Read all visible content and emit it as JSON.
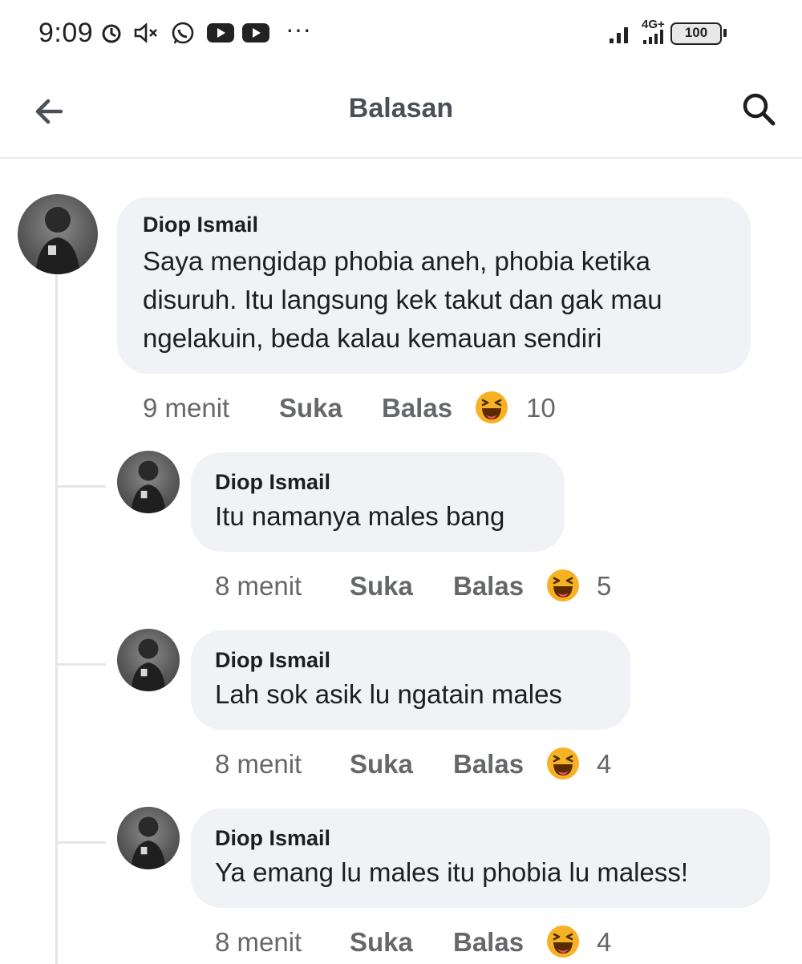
{
  "status_bar": {
    "time": "9:09",
    "network_label": "4G+",
    "battery": "100",
    "overflow": "···",
    "icons": [
      "alarm-icon",
      "mute-icon",
      "whatsapp-icon",
      "youtube-icon",
      "youtube-icon",
      "signal-icon",
      "battery-icon"
    ]
  },
  "header": {
    "title": "Balasan",
    "back_icon": "arrow-left-icon",
    "search_icon": "search-icon"
  },
  "colors": {
    "bubble": "#f0f2f5",
    "meta": "#65676b",
    "text": "#1c1e21",
    "haha": "#f7b125"
  },
  "comments": [
    {
      "author": "Diop Ismail",
      "text_lines": [
        "Saya mengidap phobia aneh, phobia ketika",
        "disuruh. Itu langsung kek takut dan gak mau",
        "ngelakuin, beda kalau kemauan sendiri"
      ],
      "time": "9 menit",
      "like": "Suka",
      "reply": "Balas",
      "reaction_icon": "haha-emoji-icon",
      "reaction_count": "10"
    },
    {
      "author": "Diop Ismail",
      "text_lines": [
        "Itu namanya males bang"
      ],
      "time": "8 menit",
      "like": "Suka",
      "reply": "Balas",
      "reaction_icon": "haha-emoji-icon",
      "reaction_count": "5"
    },
    {
      "author": "Diop Ismail",
      "text_lines": [
        "Lah sok asik lu ngatain males"
      ],
      "time": "8 menit",
      "like": "Suka",
      "reply": "Balas",
      "reaction_icon": "haha-emoji-icon",
      "reaction_count": "4"
    },
    {
      "author": "Diop Ismail",
      "text_lines": [
        "Ya emang lu males itu phobia lu maless!"
      ],
      "time": "8 menit",
      "like": "Suka",
      "reply": "Balas",
      "reaction_icon": "haha-emoji-icon",
      "reaction_count": "4"
    }
  ]
}
